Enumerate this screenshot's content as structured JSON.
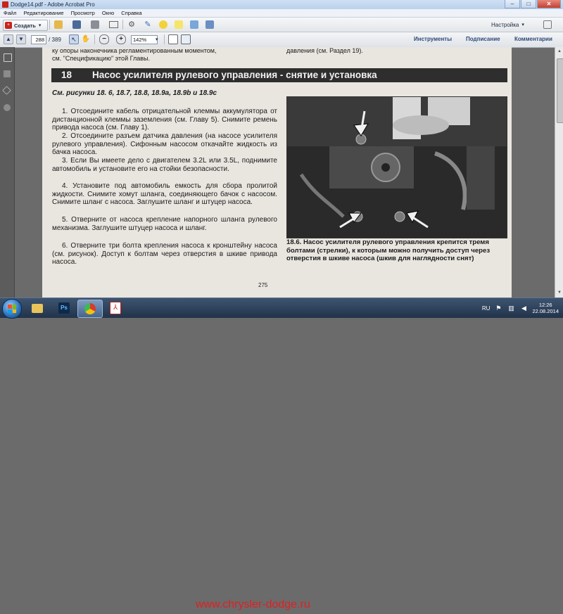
{
  "window": {
    "title": "Dodge14.pdf - Adobe Acrobat Pro",
    "controls": {
      "minimize": "–",
      "maximize": "□",
      "close": "✕"
    }
  },
  "menu": {
    "items": [
      "Файл",
      "Редактирование",
      "Просмотр",
      "Окно",
      "Справка"
    ]
  },
  "toolbar": {
    "create_label": "Создать",
    "customize_label": "Настройка",
    "dropdown_glyph": "▾",
    "page_current": "288",
    "page_total": "/ 389",
    "zoom_value": "142%",
    "tools_label": "Инструменты",
    "sign_label": "Подписание",
    "comment_label": "Комментарии"
  },
  "document": {
    "top_left_lines": [
      "ку опоры наконечника регламентированным моментом,",
      "см. \"Спецификацию\" этой Главы."
    ],
    "top_right_line": "давления (см. Раздел 19).",
    "section_number": "18",
    "section_title": "Насос усилителя рулевого управления - снятие и установка",
    "see_figures": "См. рисунки 18. 6, 18.7, 18.8, 18.9a, 18.9b и 18.9c",
    "steps": [
      "1. Отсоедините кабель отрицательной клеммы аккумулятора от дистанционной клеммы заземления (см. Главу 5). Снимите ремень привода насоса (см. Главу 1).",
      "2. Отсоедините разъем датчика давления (на насосе усилителя рулевого управления). Сифонным насосом откачайте жидкость из бачка насоса.",
      "3. Если Вы имеете дело с двигателем 3.2L или 3.5L, поднимите автомобиль и установите его на стойки безопасности.",
      "4. Установите под автомобиль емкость для сбора пролитой жидкости. Снимите хомут шланга, соединяющего бачок с насосом. Снимите шланг с насоса. Заглушите шланг и штуцер насоса.",
      "5. Отверните от насоса крепление напорного шланга рулевого механизма. Заглушите штуцер насоса и шланг.",
      "6. Отверните три болта крепления насоса к кронштейну насоса (см. рисунок). Доступ к болтам через отверстия в шкиве привода насоса."
    ],
    "caption": "18.6. Насос усилителя рулевого управления крепится тремя болтами (стрелки), к которым можно получить доступ через отверстия в шкиве насоса (шкив для наглядности снят)",
    "page_number": "275"
  },
  "taskbar": {
    "watermark": "www.chrysler-dodge.ru",
    "lang": "RU",
    "time": "12:26",
    "date": "22.08.2014",
    "apps": [
      "photoshop-icon",
      "chrome-icon",
      "acrobat-icon"
    ]
  },
  "colors": {
    "heading_bg": "#2e2e2e",
    "page_bg": "#e9e6e0",
    "watermark": "#e02020",
    "acrobat_red": "#c8241b"
  }
}
